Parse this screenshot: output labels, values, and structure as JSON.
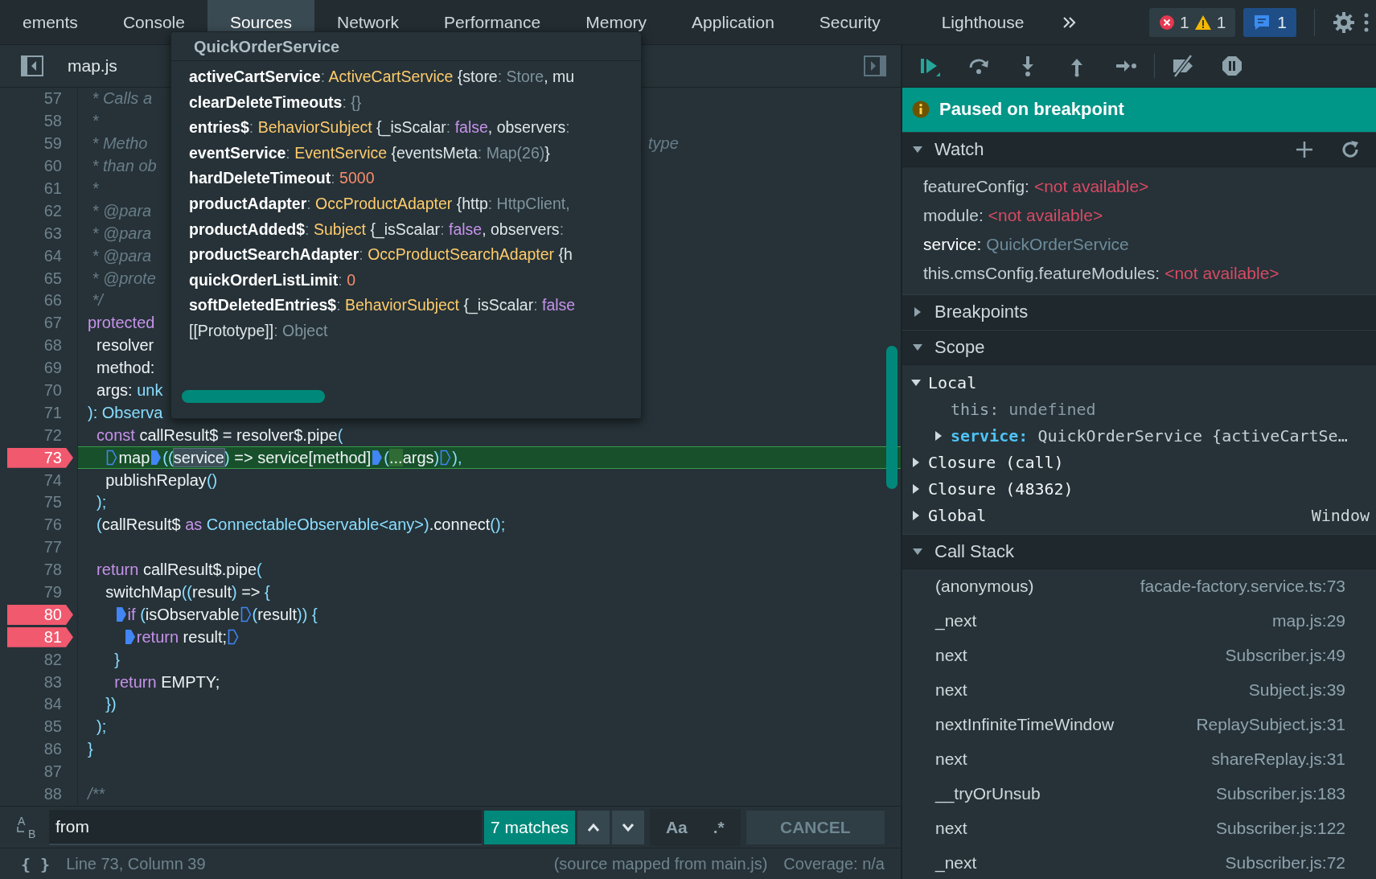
{
  "tabs": [
    {
      "label": "ements",
      "selected": false
    },
    {
      "label": "Console",
      "selected": false
    },
    {
      "label": "Sources",
      "selected": true
    },
    {
      "label": "Network",
      "selected": false
    },
    {
      "label": "Performance",
      "selected": false
    },
    {
      "label": "Memory",
      "selected": false
    },
    {
      "label": "Application",
      "selected": false
    },
    {
      "label": "Security",
      "selected": false
    },
    {
      "label": "Lighthouse",
      "selected": false
    }
  ],
  "counters": {
    "errors": "1",
    "warnings": "1",
    "messages": "1"
  },
  "editor": {
    "file_tab": "map.js",
    "lines": [
      {
        "number": "57",
        "breakpoint": false,
        "current": false,
        "segments": [
          {
            "text": " * Calls a",
            "kind": "comment"
          }
        ]
      },
      {
        "number": "58",
        "breakpoint": false,
        "current": false,
        "segments": [
          {
            "text": " *",
            "kind": "comment"
          }
        ]
      },
      {
        "number": "59",
        "breakpoint": false,
        "current": false,
        "segments": [
          {
            "text": " * Metho",
            "kind": "comment"
          }
        ],
        "tail": "type"
      },
      {
        "number": "60",
        "breakpoint": false,
        "current": false,
        "segments": [
          {
            "text": " * than ob",
            "kind": "comment"
          }
        ]
      },
      {
        "number": "61",
        "breakpoint": false,
        "current": false,
        "segments": [
          {
            "text": " *",
            "kind": "comment"
          }
        ]
      },
      {
        "number": "62",
        "breakpoint": false,
        "current": false,
        "segments": [
          {
            "text": " * @para",
            "kind": "comment"
          }
        ]
      },
      {
        "number": "63",
        "breakpoint": false,
        "current": false,
        "segments": [
          {
            "text": " * @para",
            "kind": "comment"
          }
        ]
      },
      {
        "number": "64",
        "breakpoint": false,
        "current": false,
        "segments": [
          {
            "text": " * @para",
            "kind": "comment"
          }
        ]
      },
      {
        "number": "65",
        "breakpoint": false,
        "current": false,
        "segments": [
          {
            "text": " * @prote",
            "kind": "comment"
          }
        ]
      },
      {
        "number": "66",
        "breakpoint": false,
        "current": false,
        "segments": [
          {
            "text": " */",
            "kind": "comment"
          }
        ]
      },
      {
        "number": "67",
        "breakpoint": false,
        "current": false,
        "segments": [
          {
            "text": "protected",
            "kind": "keyword"
          }
        ]
      },
      {
        "number": "68",
        "breakpoint": false,
        "current": false,
        "segments": [
          {
            "text": "  resolver",
            "kind": "plain"
          }
        ]
      },
      {
        "number": "69",
        "breakpoint": false,
        "current": false,
        "segments": [
          {
            "text": "  method:",
            "kind": "plain"
          }
        ]
      },
      {
        "number": "70",
        "breakpoint": false,
        "current": false,
        "segments": [
          {
            "text": "  args: ",
            "kind": "plain"
          },
          {
            "text": "unk",
            "kind": "accent"
          }
        ]
      },
      {
        "number": "71",
        "breakpoint": false,
        "current": false,
        "segments": [
          {
            "text": "): Observa",
            "kind": "accent"
          }
        ]
      },
      {
        "number": "72",
        "breakpoint": false,
        "current": false,
        "segments": [
          {
            "text": "  const",
            "kind": "keyword"
          },
          {
            "text": " callResult$ = resolver$.pipe",
            "kind": "plain"
          },
          {
            "text": "(",
            "kind": "accent"
          }
        ]
      },
      {
        "number": "73",
        "breakpoint": true,
        "current": true,
        "segments": [
          {
            "kind": "marker",
            "active": false
          },
          {
            "text": "map",
            "kind": "plain"
          },
          {
            "kind": "marker",
            "active": true
          },
          {
            "text": "((",
            "kind": "accent"
          },
          {
            "text": "service",
            "kind": "hover"
          },
          {
            "text": ")",
            "kind": "accent"
          },
          {
            "text": " => service[method]",
            "kind": "plain"
          },
          {
            "kind": "marker",
            "active": true
          },
          {
            "text": "(",
            "kind": "accent"
          },
          {
            "text": "...",
            "kind": "mark"
          },
          {
            "text": "args",
            "kind": "plain"
          },
          {
            "text": ")",
            "kind": "accent"
          },
          {
            "kind": "marker",
            "active": false
          },
          {
            "text": "),",
            "kind": "accent"
          }
        ]
      },
      {
        "number": "74",
        "breakpoint": false,
        "current": false,
        "segments": [
          {
            "text": "    publishReplay",
            "kind": "plain"
          },
          {
            "text": "()",
            "kind": "accent"
          }
        ]
      },
      {
        "number": "75",
        "breakpoint": false,
        "current": false,
        "segments": [
          {
            "text": "  );",
            "kind": "accent"
          }
        ]
      },
      {
        "number": "76",
        "breakpoint": false,
        "current": false,
        "segments": [
          {
            "text": "  (",
            "kind": "accent"
          },
          {
            "text": "callResult$ ",
            "kind": "plain"
          },
          {
            "text": "as",
            "kind": "keyword"
          },
          {
            "text": " ConnectableObservable<any>)",
            "kind": "accent"
          },
          {
            "text": ".connect",
            "kind": "plain"
          },
          {
            "text": "();",
            "kind": "accent"
          }
        ]
      },
      {
        "number": "77",
        "breakpoint": false,
        "current": false
      },
      {
        "number": "78",
        "breakpoint": false,
        "current": false,
        "segments": [
          {
            "text": "  return",
            "kind": "keyword"
          },
          {
            "text": " callResult$.pipe",
            "kind": "plain"
          },
          {
            "text": "(",
            "kind": "accent"
          }
        ]
      },
      {
        "number": "79",
        "breakpoint": false,
        "current": false,
        "segments": [
          {
            "text": "    switchMap",
            "kind": "plain"
          },
          {
            "text": "((",
            "kind": "accent"
          },
          {
            "text": "result",
            "kind": "plain"
          },
          {
            "text": ")",
            "kind": "accent"
          },
          {
            "text": " => ",
            "kind": "plain"
          },
          {
            "text": "{",
            "kind": "accent"
          }
        ]
      },
      {
        "number": "80",
        "breakpoint": true,
        "current": false,
        "segments": [
          {
            "kind": "marker",
            "active": true
          },
          {
            "text": "if",
            "kind": "keyword"
          },
          {
            "text": " (",
            "kind": "accent"
          },
          {
            "text": "isObservable",
            "kind": "plain"
          },
          {
            "kind": "marker",
            "active": false
          },
          {
            "text": "(",
            "kind": "accent"
          },
          {
            "text": "result",
            "kind": "plain"
          },
          {
            "text": ")) {",
            "kind": "accent"
          }
        ]
      },
      {
        "number": "81",
        "breakpoint": true,
        "current": false,
        "segments": [
          {
            "kind": "marker",
            "active": true
          },
          {
            "text": "return",
            "kind": "keyword"
          },
          {
            "text": " result;",
            "kind": "plain"
          },
          {
            "kind": "marker",
            "active": false
          }
        ]
      },
      {
        "number": "82",
        "breakpoint": false,
        "current": false,
        "segments": [
          {
            "text": "      }",
            "kind": "accent"
          }
        ]
      },
      {
        "number": "83",
        "breakpoint": false,
        "current": false,
        "segments": [
          {
            "text": "      return",
            "kind": "keyword"
          },
          {
            "text": " EMPTY;",
            "kind": "plain"
          }
        ]
      },
      {
        "number": "84",
        "breakpoint": false,
        "current": false,
        "segments": [
          {
            "text": "    })",
            "kind": "accent"
          }
        ]
      },
      {
        "number": "85",
        "breakpoint": false,
        "current": false,
        "segments": [
          {
            "text": "  );",
            "kind": "accent"
          }
        ]
      },
      {
        "number": "86",
        "breakpoint": false,
        "current": false,
        "segments": [
          {
            "text": "}",
            "kind": "accent"
          }
        ]
      },
      {
        "number": "87",
        "breakpoint": false,
        "current": false
      },
      {
        "number": "88",
        "breakpoint": false,
        "current": false,
        "segments": [
          {
            "text": "/**",
            "kind": "comment"
          }
        ]
      }
    ],
    "popup": {
      "title": "QuickOrderService",
      "entries": [
        {
          "segments": [
            {
              "text": "activeCartService",
              "kind": "key"
            },
            {
              "text": ": ",
              "kind": "punct"
            },
            {
              "text": "ActiveCartService",
              "kind": "type"
            },
            {
              "text": " {store",
              "kind": "text"
            },
            {
              "text": ": ",
              "kind": "punct"
            },
            {
              "text": "Store",
              "kind": "dim"
            },
            {
              "text": ", mu",
              "kind": "text"
            }
          ]
        },
        {
          "segments": [
            {
              "text": "clearDeleteTimeouts",
              "kind": "key"
            },
            {
              "text": ": ",
              "kind": "punct"
            },
            {
              "text": "{}",
              "kind": "dim"
            }
          ]
        },
        {
          "segments": [
            {
              "text": "entries$",
              "kind": "key"
            },
            {
              "text": ": ",
              "kind": "punct"
            },
            {
              "text": "BehaviorSubject",
              "kind": "type"
            },
            {
              "text": " {_isScalar",
              "kind": "text"
            },
            {
              "text": ": ",
              "kind": "punct"
            },
            {
              "text": "false",
              "kind": "bool"
            },
            {
              "text": ", observers",
              "kind": "text"
            },
            {
              "text": ":",
              "kind": "punct"
            }
          ]
        },
        {
          "segments": [
            {
              "text": "eventService",
              "kind": "key"
            },
            {
              "text": ": ",
              "kind": "punct"
            },
            {
              "text": "EventService",
              "kind": "type"
            },
            {
              "text": " {eventsMeta",
              "kind": "text"
            },
            {
              "text": ": ",
              "kind": "punct"
            },
            {
              "text": "Map(26)",
              "kind": "dim"
            },
            {
              "text": "}",
              "kind": "text"
            }
          ]
        },
        {
          "segments": [
            {
              "text": "hardDeleteTimeout",
              "kind": "key"
            },
            {
              "text": ": ",
              "kind": "punct"
            },
            {
              "text": "5000",
              "kind": "num"
            }
          ]
        },
        {
          "segments": [
            {
              "text": "productAdapter",
              "kind": "key"
            },
            {
              "text": ": ",
              "kind": "punct"
            },
            {
              "text": "OccProductAdapter",
              "kind": "type"
            },
            {
              "text": " {http",
              "kind": "text"
            },
            {
              "text": ": ",
              "kind": "punct"
            },
            {
              "text": "HttpClient,",
              "kind": "dim"
            }
          ]
        },
        {
          "segments": [
            {
              "text": "productAdded$",
              "kind": "key"
            },
            {
              "text": ": ",
              "kind": "punct"
            },
            {
              "text": "Subject",
              "kind": "type"
            },
            {
              "text": " {_isScalar",
              "kind": "text"
            },
            {
              "text": ": ",
              "kind": "punct"
            },
            {
              "text": "false",
              "kind": "bool"
            },
            {
              "text": ", observers",
              "kind": "text"
            },
            {
              "text": ":",
              "kind": "punct"
            }
          ]
        },
        {
          "segments": [
            {
              "text": "productSearchAdapter",
              "kind": "key"
            },
            {
              "text": ": ",
              "kind": "punct"
            },
            {
              "text": "OccProductSearchAdapter",
              "kind": "type"
            },
            {
              "text": " {h",
              "kind": "text"
            }
          ]
        },
        {
          "segments": [
            {
              "text": "quickOrderListLimit",
              "kind": "key"
            },
            {
              "text": ": ",
              "kind": "punct"
            },
            {
              "text": "0",
              "kind": "num"
            }
          ]
        },
        {
          "segments": [
            {
              "text": "softDeletedEntries$",
              "kind": "key"
            },
            {
              "text": ": ",
              "kind": "punct"
            },
            {
              "text": "BehaviorSubject",
              "kind": "type"
            },
            {
              "text": " {_isScalar",
              "kind": "text"
            },
            {
              "text": ": ",
              "kind": "punct"
            },
            {
              "text": "false",
              "kind": "bool"
            }
          ]
        },
        {
          "segments": [
            {
              "text": "[[Prototype]]",
              "kind": "text"
            },
            {
              "text": ": ",
              "kind": "punct"
            },
            {
              "text": "Object",
              "kind": "dim"
            }
          ]
        }
      ]
    },
    "search": {
      "replace_letters": [
        "A",
        "B"
      ],
      "query": "from",
      "matches": "7 matches",
      "case_button": "Aa",
      "regex_button": ".*",
      "cancel": "CANCEL"
    },
    "status": {
      "format_button": "{ }",
      "position": "Line 73, Column 39",
      "source_map": "(source mapped from main.js)",
      "coverage": "Coverage: n/a"
    }
  },
  "debugger": {
    "toolbar": [
      {
        "kind": "resume"
      },
      {
        "kind": "step_over"
      },
      {
        "kind": "step_into"
      },
      {
        "kind": "step_out"
      },
      {
        "kind": "step"
      },
      {
        "kind": "deactivate"
      },
      {
        "kind": "pause_exceptions"
      }
    ],
    "status": "Paused on breakpoint",
    "watch": {
      "title": "Watch",
      "expanded": true,
      "items": [
        {
          "name": "featureConfig:",
          "value": "<not available>",
          "available": false
        },
        {
          "name": "module:",
          "value": "<not available>",
          "available": false
        },
        {
          "name": "service:",
          "value": "QuickOrderService",
          "available": true
        },
        {
          "name": "this.cmsConfig.featureModules:",
          "value": "<not available>",
          "available": false
        }
      ]
    },
    "breakpoints": {
      "title": "Breakpoints",
      "expanded": false
    },
    "scope": {
      "title": "Scope",
      "expanded": true,
      "items": [
        {
          "kind": "scope",
          "label": "Local",
          "expanded": true,
          "children": [
            {
              "kind": "primitive",
              "label": "this:",
              "value": "undefined"
            },
            {
              "kind": "object",
              "label": "service:",
              "value": "QuickOrderService {activeCartSe…",
              "expanded": false
            }
          ]
        },
        {
          "kind": "scope",
          "label": "Closure (call)",
          "expanded": false
        },
        {
          "kind": "scope",
          "label": "Closure (48362)",
          "expanded": false
        },
        {
          "kind": "scope",
          "label": "Global",
          "value": "Window",
          "expanded": false
        }
      ]
    },
    "call_stack": {
      "title": "Call Stack",
      "expanded": true,
      "frames": [
        {
          "function": "(anonymous)",
          "location": "facade-factory.service.ts:73"
        },
        {
          "function": "_next",
          "location": "map.js:29"
        },
        {
          "function": "next",
          "location": "Subscriber.js:49"
        },
        {
          "function": "next",
          "location": "Subject.js:39"
        },
        {
          "function": "nextInfiniteTimeWindow",
          "location": "ReplaySubject.js:31"
        },
        {
          "function": "next",
          "location": "shareReplay.js:31"
        },
        {
          "function": "__tryOrUnsub",
          "location": "Subscriber.js:183"
        },
        {
          "function": "next",
          "location": "Subscriber.js:122"
        },
        {
          "function": "_next",
          "location": "Subscriber.js:72"
        }
      ]
    }
  }
}
